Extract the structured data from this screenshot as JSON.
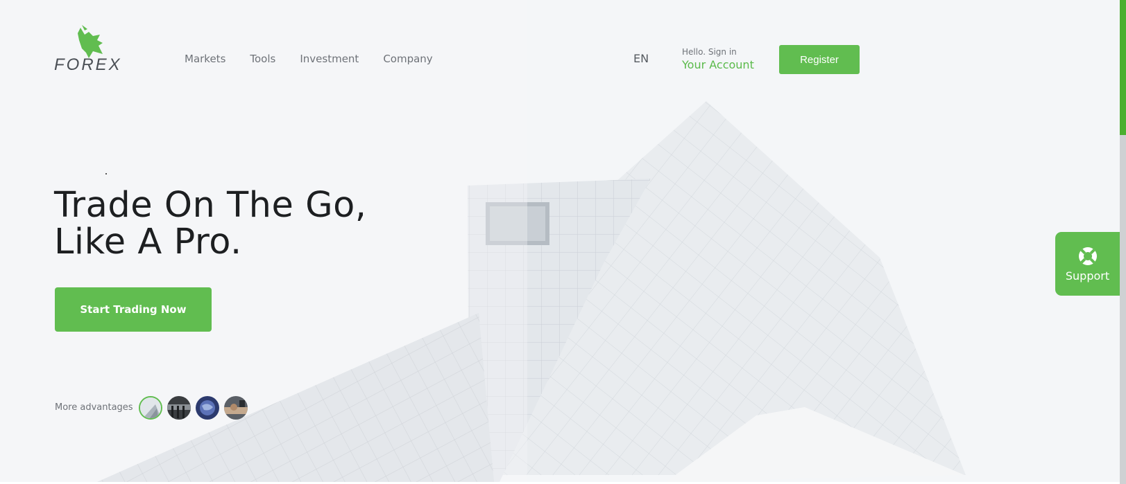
{
  "brand": {
    "logo_text": "FOREX",
    "accent_color": "#61bd50",
    "logo_icon": "bull-head-icon"
  },
  "nav": {
    "items": [
      {
        "label": "Markets"
      },
      {
        "label": "Tools"
      },
      {
        "label": "Investment"
      },
      {
        "label": "Company"
      }
    ]
  },
  "header": {
    "language": "EN",
    "account_greeting": "Hello. Sign in",
    "account_link": "Your Account",
    "register_label": "Register"
  },
  "hero": {
    "title_line1": "Trade On The Go,",
    "title_line2": "Like A Pro.",
    "cta_label": "Start Trading Now",
    "advantages_label": "More advantages",
    "advantage_thumbnails": [
      "building-thumbnail",
      "office-thumbnail",
      "globe-thumbnail",
      "handshake-thumbnail"
    ]
  },
  "support": {
    "label": "Support",
    "icon": "lifebuoy-icon"
  },
  "scrollbar": {
    "thumb_color": "#4caf2f"
  }
}
